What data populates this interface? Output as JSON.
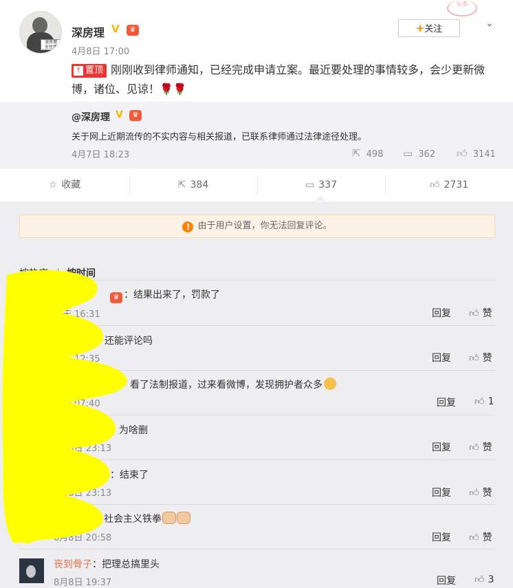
{
  "post": {
    "user_name": "深房理",
    "verified": "V",
    "time": "4月8日 17:00",
    "follow_label": "关注",
    "pin_label": "置顶",
    "text": "刚刚收到律师通知，已经完成申请立案。最近要处理的事情较多，会少更新微博，诸位、见谅！🌹🌹"
  },
  "repost": {
    "user_name": "@深房理",
    "verified": "V",
    "text": "关于网上近期流传的不实内容与相关报道，已联系律师通过法律途径处理。",
    "time": "4月7日 18:23",
    "shares": "498",
    "comments": "362",
    "likes": "3141"
  },
  "actions": {
    "favorite": "收藏",
    "share": "384",
    "comment": "337",
    "like": "2731"
  },
  "notice": "由于用户设置，你无法回复评论。",
  "sort": {
    "hot": "按热度",
    "time": "按时间"
  },
  "reply_label": "回复",
  "comments": [
    {
      "name": "",
      "text": "：结果出来了，罚款了",
      "time": "今天 16:31",
      "likes": "赞"
    },
    {
      "name": "",
      "text": "还能评论吗",
      "time": "今天 12:35",
      "likes": "赞"
    },
    {
      "name": "",
      "text": "看了法制报道，过来看微博，发现拥护者众多",
      "time": "今天 07:40",
      "likes": "1"
    },
    {
      "name": "",
      "text": "为啥删",
      "time": "8月8日 23:13",
      "likes": "赞"
    },
    {
      "name": "",
      "text": "：结束了",
      "time": "8月8日 23:13",
      "likes": "赞"
    },
    {
      "name": "",
      "text": "社会主义铁拳",
      "time": "8月8日 20:58",
      "likes": "赞"
    },
    {
      "name": "丧到骨子",
      "text": "：把理总搞里头",
      "time": "8月8日 19:37",
      "likes": "3"
    }
  ],
  "icons": {
    "favorite": "star-icon",
    "share": "share-icon",
    "comment": "comment-icon",
    "like": "thumbs-up-icon",
    "warn": "warning-icon",
    "more": "chevron-down-icon"
  },
  "colors": {
    "accent": "#ff8200",
    "pin": "#e33333",
    "name_link": "#eb7350",
    "highlight": "#ffff00"
  }
}
